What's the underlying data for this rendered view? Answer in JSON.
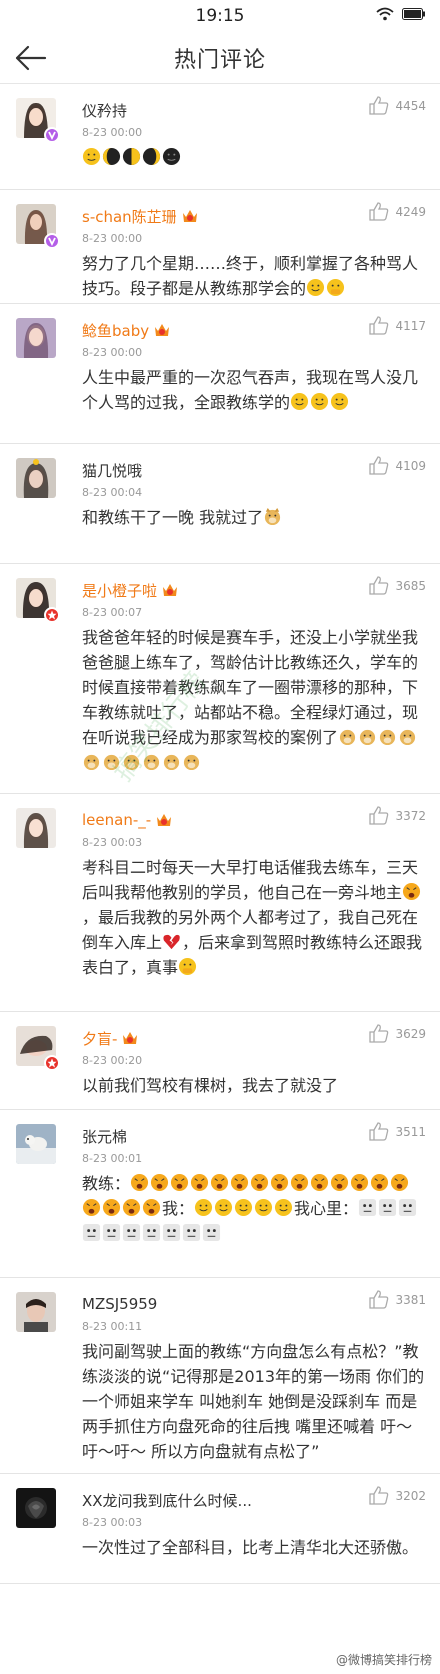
{
  "status": {
    "time": "19:15"
  },
  "header": {
    "title": "热门评论"
  },
  "comments": [
    {
      "name": "仪矜持",
      "time": "8-23 00:00",
      "likes": "4454",
      "text": "",
      "name_color": "normal",
      "badge": "purple",
      "crown": false
    },
    {
      "name": "s-chan陈芷珊",
      "time": "8-23 00:00",
      "likes": "4249",
      "text": "努力了几个星期……终于，顺利掌握了各种骂人技巧。段子都是从教练那学会的",
      "name_color": "orange",
      "badge": "purple",
      "crown": true
    },
    {
      "name": "鲶鱼baby",
      "time": "8-23 00:00",
      "likes": "4117",
      "text": "人生中最严重的一次忍气吞声，我现在骂人没几个人骂的过我，全跟教练学的",
      "name_color": "orange",
      "badge": "",
      "crown": true
    },
    {
      "name": "猫几悦哦",
      "time": "8-23 00:04",
      "likes": "4109",
      "text": "和教练干了一晚 我就过了",
      "name_color": "normal",
      "badge": "",
      "crown": false
    },
    {
      "name": "是小橙子啦",
      "time": "8-23 00:07",
      "likes": "3685",
      "text": "我爸爸年轻的时候是赛车手，还没上小学就坐我爸爸腿上练车了，驾龄估计比教练还久，学车的时候直接带着教练飙车了一圈带漂移的那种，下车教练就吐了，站都站不稳。全程绿灯通过，现在听说我已经成为那家驾校的案例了",
      "name_color": "orange",
      "badge": "red",
      "crown": true
    },
    {
      "name": "leenan-_-",
      "time": "8-23 00:03",
      "likes": "3372",
      "text_a": "考科目二时每天一大早打电话催我去练车，三天后叫我帮他教别的学员，他自己在一旁斗地主",
      "text_b": "，最后我教的另外两个人都考过了，我自己死在倒车入库上",
      "text_c": "，后来拿到驾照时教练特么还跟我表白了，真事",
      "name_color": "orange",
      "badge": "",
      "crown": true
    },
    {
      "name": "夕盲-",
      "time": "8-23 00:20",
      "likes": "3629",
      "text": "以前我们驾校有棵树，我去了就没了",
      "name_color": "orange",
      "badge": "red",
      "crown": true
    },
    {
      "name": "张元棉",
      "time": "8-23 00:01",
      "likes": "3511",
      "text_a": "教练：",
      "text_b": "我：",
      "text_c": "我心里：",
      "name_color": "normal",
      "badge": "",
      "crown": false
    },
    {
      "name": "MZSJ5959",
      "time": "8-23 00:11",
      "likes": "3381",
      "text": "我问副驾驶上面的教练“方向盘怎么有点松？”教练淡淡的说“记得那是2013年的第一场雨 你们的一个师姐来学车 叫她刹车 她倒是没踩刹车 而是两手抓住方向盘死命的往后拽 嘴里还喊着 吁～吁～吁～ 所以方向盘就有点松了”",
      "name_color": "normal",
      "badge": "",
      "crown": false
    },
    {
      "name": "XX龙问我到底什么时候...",
      "time": "8-23 00:03",
      "likes": "3202",
      "text": "一次性过了全部科目，比考上清华北大还骄傲。",
      "name_color": "normal",
      "badge": "",
      "crown": false
    }
  ],
  "watermark": {
    "text": "搞笑排行榜"
  },
  "footer": {
    "mark": "@微博搞笑排行榜"
  },
  "colors": {
    "accent_orange": "#f07a17",
    "badge_purple": "#b45ee8",
    "badge_red": "#e8322b",
    "divider": "#e4e4e4"
  }
}
